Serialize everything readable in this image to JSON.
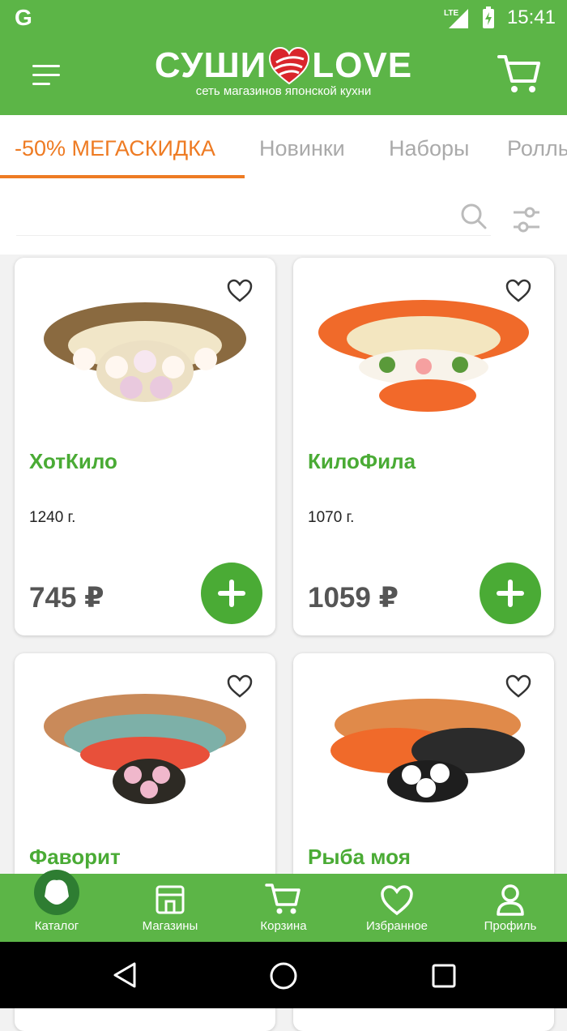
{
  "status": {
    "carrier_icon": "google-icon",
    "network": "LTE",
    "time": "15:41"
  },
  "header": {
    "brand_left": "СУШИ",
    "brand_right": "LOVE",
    "tagline": "сеть магазинов японской кухни"
  },
  "tabs": [
    {
      "label": "-50% МЕГАСКИДКА"
    },
    {
      "label": "Новинки"
    },
    {
      "label": "Наборы"
    },
    {
      "label": "Роллы"
    }
  ],
  "products": [
    {
      "name": "ХотКило",
      "weight": "1240 г.",
      "price": "745 ₽"
    },
    {
      "name": "КилоФила",
      "weight": "1070 г.",
      "price": "1059 ₽"
    },
    {
      "name": "Фаворит",
      "weight": "",
      "price": ""
    },
    {
      "name": "Рыба моя",
      "weight": "",
      "price": ""
    }
  ],
  "nav": [
    {
      "label": "Каталог"
    },
    {
      "label": "Магазины"
    },
    {
      "label": "Корзина"
    },
    {
      "label": "Избранное"
    },
    {
      "label": "Профиль"
    }
  ],
  "colors": {
    "brand_green": "#5cb547",
    "accent_orange": "#ee7b23",
    "title_green": "#4aab35"
  }
}
